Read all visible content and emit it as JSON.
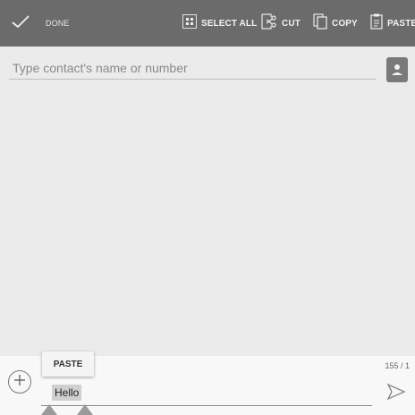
{
  "action_bar": {
    "done_label": "DONE",
    "select_all_label": "SELECT ALL",
    "cut_label": "CUT",
    "copy_label": "COPY",
    "paste_label": "PASTE",
    "background": "#6b6b6b"
  },
  "recipient": {
    "placeholder": "Type contact's name or number"
  },
  "compose": {
    "char_counter": "155 / 1",
    "message_text": "Hello"
  },
  "popup": {
    "paste_label": "PASTE"
  },
  "icons": {
    "done": "check-icon",
    "select_all": "select-all-icon",
    "cut": "cut-icon",
    "copy": "copy-icon",
    "paste": "paste-icon",
    "contact": "contact-card-icon",
    "attach": "plus-circle-icon",
    "send": "send-icon"
  }
}
